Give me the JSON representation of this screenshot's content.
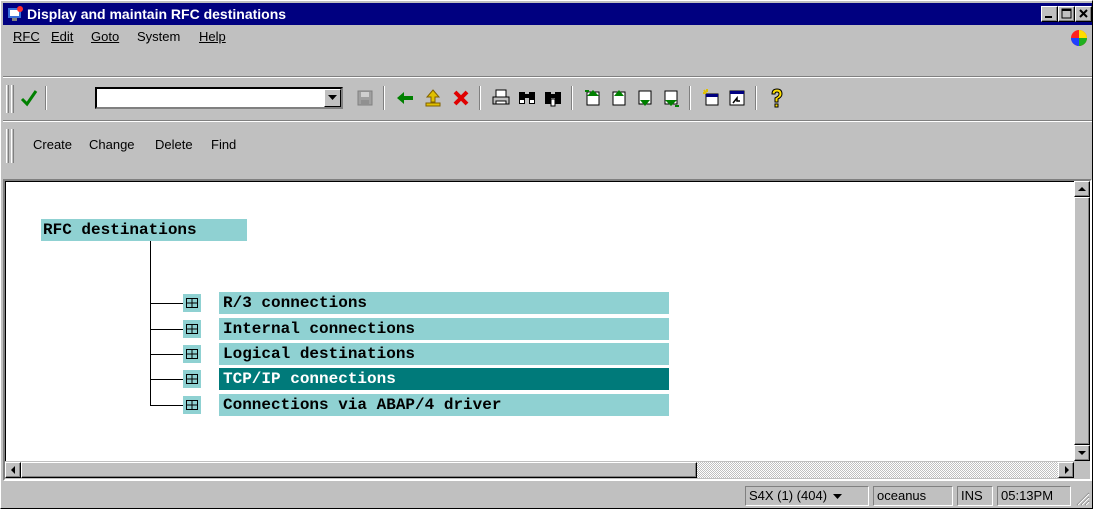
{
  "window": {
    "title": "Display and maintain RFC destinations"
  },
  "menu": {
    "items": [
      {
        "label": "RFC"
      },
      {
        "label": "Edit"
      },
      {
        "label": "Goto"
      },
      {
        "label": "System"
      },
      {
        "label": "Help"
      }
    ]
  },
  "toolbar": {
    "command_field_value": "",
    "icons": [
      "enter-check-icon",
      "save-icon",
      "back-icon",
      "exit-icon",
      "cancel-icon",
      "print-icon",
      "find-icon",
      "find-next-icon",
      "first-page-icon",
      "previous-page-icon",
      "next-page-icon",
      "last-page-icon",
      "create-session-icon",
      "shortcut-icon",
      "help-icon"
    ]
  },
  "app_toolbar": {
    "create": "Create",
    "change": "Change",
    "delete": "Delete",
    "find": "Find"
  },
  "tree": {
    "root": "RFC destinations",
    "nodes": [
      {
        "label": "R/3 connections",
        "selected": false
      },
      {
        "label": "Internal connections",
        "selected": false
      },
      {
        "label": "Logical destinations",
        "selected": false
      },
      {
        "label": "TCP/IP connections",
        "selected": true
      },
      {
        "label": "Connections via ABAP/4 driver",
        "selected": false
      }
    ]
  },
  "status": {
    "system": "S4X (1) (404)",
    "server": "oceanus",
    "mode": "INS",
    "time": "05:13PM"
  },
  "colors": {
    "titlebar": "#000080",
    "tree_node_bg": "#8fd1d2",
    "tree_selected_bg": "#007a7a"
  }
}
